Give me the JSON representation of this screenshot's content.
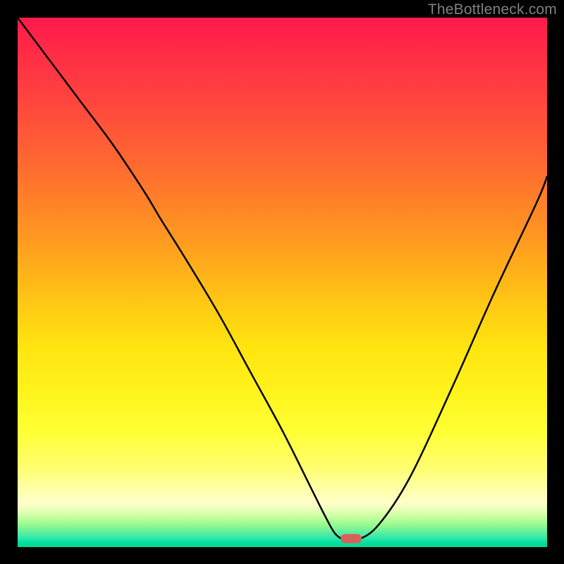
{
  "watermark": "TheBottleneck.com",
  "chart_data": {
    "type": "line",
    "title": "",
    "xlabel": "",
    "ylabel": "",
    "xlim": [
      0,
      100
    ],
    "ylim": [
      0,
      100
    ],
    "grid": false,
    "series": [
      {
        "name": "bottleneck-curve",
        "x": [
          0,
          6,
          12,
          18,
          24,
          27,
          32,
          38,
          44,
          50,
          55,
          58,
          60,
          62,
          64,
          68,
          74,
          82,
          90,
          98,
          100
        ],
        "values": [
          100,
          92,
          84,
          76,
          67,
          62,
          54,
          44,
          33,
          22,
          12,
          6,
          2.5,
          1.3,
          1.3,
          4,
          13,
          30,
          48,
          65,
          70
        ]
      }
    ],
    "annotations": [
      {
        "name": "min-marker",
        "x": 63,
        "y": 1.6,
        "shape": "pill",
        "color": "#d9605a"
      }
    ],
    "background": {
      "type": "vertical-gradient",
      "stops": [
        {
          "pos": 0.0,
          "color": "#ff1a4b"
        },
        {
          "pos": 0.5,
          "color": "#ffc814"
        },
        {
          "pos": 0.8,
          "color": "#ffff33"
        },
        {
          "pos": 0.93,
          "color": "#e8ffb8"
        },
        {
          "pos": 1.0,
          "color": "#00da90"
        }
      ]
    }
  }
}
